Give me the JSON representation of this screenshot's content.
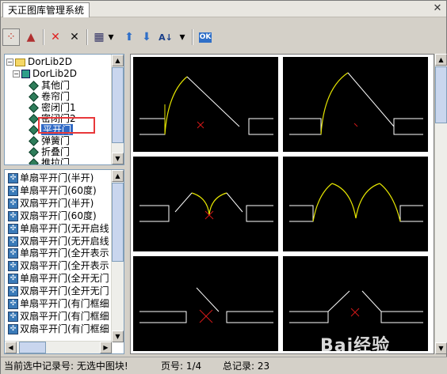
{
  "window": {
    "tab_title": "天正图库管理系统",
    "close_glyph": "✕"
  },
  "toolbar": {
    "items": [
      {
        "name": "layout-icon",
        "glyph": "⁘",
        "color": "#c0392b"
      },
      {
        "name": "pattern-icon",
        "glyph": "▲",
        "color": "#b03030"
      },
      {
        "name": "delete-red-icon",
        "glyph": "✕",
        "color": "#e02020"
      },
      {
        "name": "delete-black-icon",
        "glyph": "✕",
        "color": "#111111"
      },
      {
        "name": "view-mode-icon",
        "glyph": "▦",
        "color": "#333366"
      },
      {
        "name": "dropdown-arrow-icon",
        "glyph": "▾",
        "color": "#000000"
      },
      {
        "name": "move-up-icon",
        "glyph": "⬆",
        "color": "#2f6fc8"
      },
      {
        "name": "move-down-icon",
        "glyph": "⬇",
        "color": "#2f6fc8"
      },
      {
        "name": "sort-az-icon",
        "glyph": "A↓",
        "color": "#1a3f8a"
      },
      {
        "name": "dropdown-arrow-icon",
        "glyph": "▾",
        "color": "#000000"
      },
      {
        "name": "ok-icon",
        "glyph": "OK",
        "color": "#1a5fb4"
      }
    ]
  },
  "tree": {
    "root_label": "DorLib2D",
    "child_label": "DorLib2D",
    "items": [
      "其他门",
      "卷帘门",
      "密闭门1",
      "密闭门2",
      "平开门",
      "弹簧门",
      "折叠门",
      "推拉门"
    ],
    "selected_index": 4
  },
  "list": {
    "items": [
      "单扇平开门(半开)",
      "单扇平开门(60度)",
      "双扇平开门(半开)",
      "双扇平开门(60度)",
      "单扇平开门(无开启线",
      "双扇平开门(无开启线",
      "单扇平开门(全开表示",
      "双扇平开门(全开表示",
      "单扇平开门(全开无门",
      "双扇平开门(全开无门",
      "单扇平开门(有门框细",
      "双扇平开门(有门框细",
      "双扇平开门(有门框细"
    ]
  },
  "status": {
    "current": "当前选中记录号: 无选中图块!",
    "page": "页号: 1/4",
    "total": "总记录: 23"
  },
  "watermark": "Bai经验",
  "colors": {
    "door_line": "#e6e600",
    "wall_line": "#ffffff",
    "marker": "#d01818",
    "highlight": "#e8383a"
  }
}
